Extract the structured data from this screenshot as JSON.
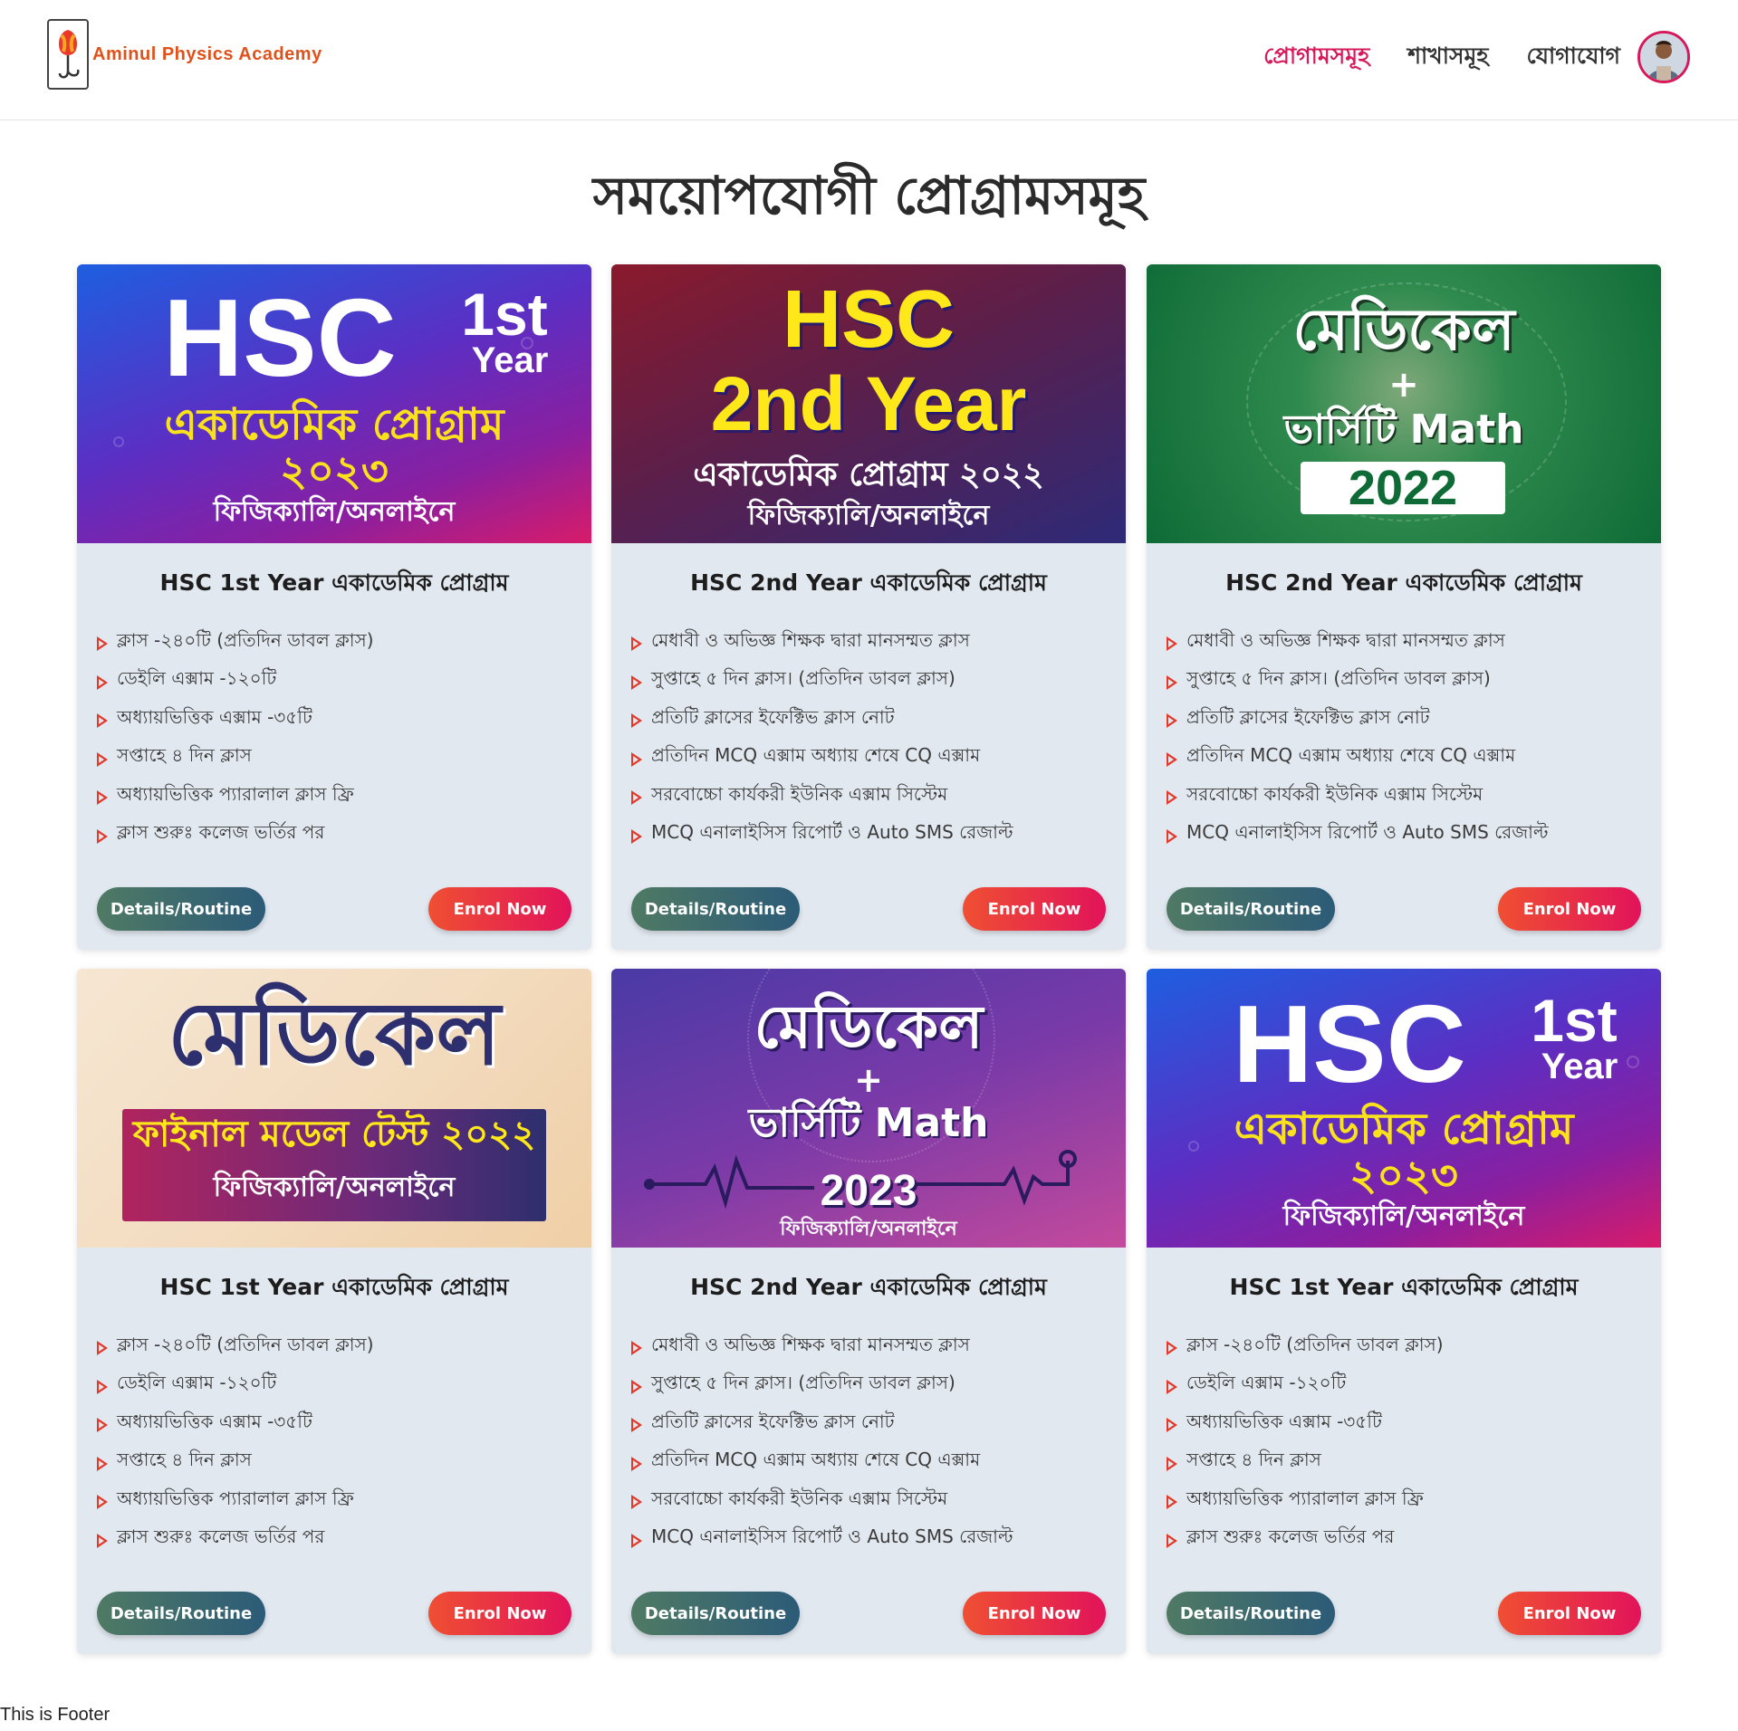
{
  "brand": {
    "name": "Aminul Physics Academy"
  },
  "nav": {
    "links": [
      {
        "label": "প্রোগামসমূহ",
        "active": true
      },
      {
        "label": "শাখাসমূহ",
        "active": false
      },
      {
        "label": "যোগাযোগ",
        "active": false
      }
    ]
  },
  "page": {
    "title": "সময়োপযোগী প্রোগ্রামসমূহ"
  },
  "colors": {
    "accent": "#d6195a",
    "enrol_start": "#ef4f32",
    "enrol_end": "#e2135a",
    "details_start": "#4f7a64",
    "details_end": "#2c5b78",
    "card_bg": "#e2e8f0",
    "bullet": "#e23a2a"
  },
  "cards": [
    {
      "banner": {
        "big1": "HSC",
        "big2": "1st",
        "big3": "Year",
        "line1": "একাডেমিক প্রোগ্রাম",
        "line2": "২০২৩",
        "line3": "ফিজিক্যালি/অনলাইনে"
      },
      "title": "HSC 1st Year একাডেমিক প্রোগ্রাম",
      "features": [
        "ক্লাস -২৪০টি (প্রতিদিন ডাবল ক্লাস)",
        "ডেইলি এক্সাম -১২০টি",
        "অধ্যায়ভিত্তিক এক্সাম -৩৫টি",
        "সপ্তাহে ৪ দিন ক্লাস",
        "অধ্যায়ভিত্তিক প্যারালাল ক্লাস ফ্রি",
        "ক্লাস শুরুঃ কলেজ ভর্তির পর"
      ],
      "details_label": "Details/Routine",
      "enrol_label": "Enrol Now"
    },
    {
      "banner": {
        "big1": "HSC",
        "big2": "2nd Year",
        "line1": "একাডেমিক প্রোগ্রাম ২০২২",
        "line2": "ফিজিক্যালি/অনলাইনে"
      },
      "title": "HSC 2nd Year একাডেমিক প্রোগ্রাম",
      "features": [
        "মেধাবী ও অভিজ্ঞ শিক্ষক দ্বারা মানসম্মত ক্লাস",
        "সুপ্তাহে ৫ দিন ক্লাস। (প্রতিদিন ডাবল ক্লাস)",
        "প্রতিটি ক্লাসের ইফেক্টিভ ক্লাস নোট",
        "প্রতিদিন MCQ এক্সাম অধ্যায় শেষে CQ এক্সাম",
        "সরবোচ্চো কার্যকরী ইউনিক এক্সাম সিস্টেম",
        "MCQ এনালাইসিস রিপোর্ট ও Auto SMS রেজাল্ট"
      ],
      "details_label": "Details/Routine",
      "enrol_label": "Enrol Now"
    },
    {
      "banner": {
        "line1": "মেডিকেল",
        "plus": "+",
        "line2": "ভার্সিটি Math",
        "year": "2022"
      },
      "title": "HSC 2nd Year একাডেমিক প্রোগ্রাম",
      "features": [
        "মেধাবী ও অভিজ্ঞ শিক্ষক দ্বারা মানসম্মত ক্লাস",
        "সুপ্তাহে ৫ দিন ক্লাস। (প্রতিদিন ডাবল ক্লাস)",
        "প্রতিটি ক্লাসের ইফেক্টিভ ক্লাস নোট",
        "প্রতিদিন MCQ এক্সাম অধ্যায় শেষে CQ এক্সাম",
        "সরবোচ্চো কার্যকরী ইউনিক এক্সাম সিস্টেম",
        "MCQ এনালাইসিস রিপোর্ট ও Auto SMS রেজাল্ট"
      ],
      "details_label": "Details/Routine",
      "enrol_label": "Enrol Now"
    },
    {
      "banner": {
        "line1": "মেডিকেল",
        "line2": "ফাইনাল মডেল টেস্ট ২০২২",
        "line3": "ফিজিক্যালি/অনলাইনে"
      },
      "title": "HSC 1st Year একাডেমিক প্রোগ্রাম",
      "features": [
        "ক্লাস -২৪০টি (প্রতিদিন ডাবল ক্লাস)",
        "ডেইলি এক্সাম -১২০টি",
        "অধ্যায়ভিত্তিক এক্সাম -৩৫টি",
        "সপ্তাহে ৪ দিন ক্লাস",
        "অধ্যায়ভিত্তিক প্যারালাল ক্লাস ফ্রি",
        "ক্লাস শুরুঃ কলেজ ভর্তির পর"
      ],
      "details_label": "Details/Routine",
      "enrol_label": "Enrol Now"
    },
    {
      "banner": {
        "line1": "মেডিকেল",
        "plus": "+",
        "line2": "ভার্সিটি Math",
        "year": "2023",
        "line3": "ফিজিক্যালি/অনলাইনে"
      },
      "title": "HSC 2nd Year একাডেমিক প্রোগ্রাম",
      "features": [
        "মেধাবী ও অভিজ্ঞ শিক্ষক দ্বারা মানসম্মত ক্লাস",
        "সুপ্তাহে ৫ দিন ক্লাস। (প্রতিদিন ডাবল ক্লাস)",
        "প্রতিটি ক্লাসের ইফেক্টিভ ক্লাস নোট",
        "প্রতিদিন MCQ এক্সাম অধ্যায় শেষে CQ এক্সাম",
        "সরবোচ্চো কার্যকরী ইউনিক এক্সাম সিস্টেম",
        "MCQ এনালাইসিস রিপোর্ট ও Auto SMS রেজাল্ট"
      ],
      "details_label": "Details/Routine",
      "enrol_label": "Enrol Now"
    },
    {
      "banner": {
        "big1": "HSC",
        "big2": "1st",
        "big3": "Year",
        "line1": "একাডেমিক প্রোগ্রাম",
        "line2": "২০২৩",
        "line3": "ফিজিক্যালি/অনলাইনে"
      },
      "title": "HSC 1st Year একাডেমিক প্রোগ্রাম",
      "features": [
        "ক্লাস -২৪০টি (প্রতিদিন ডাবল ক্লাস)",
        "ডেইলি এক্সাম -১২০টি",
        "অধ্যায়ভিত্তিক এক্সাম -৩৫টি",
        "সপ্তাহে ৪ দিন ক্লাস",
        "অধ্যায়ভিত্তিক প্যারালাল ক্লাস ফ্রি",
        "ক্লাস শুরুঃ কলেজ ভর্তির পর"
      ],
      "details_label": "Details/Routine",
      "enrol_label": "Enrol Now"
    }
  ],
  "footer": {
    "text": "This is Footer"
  }
}
